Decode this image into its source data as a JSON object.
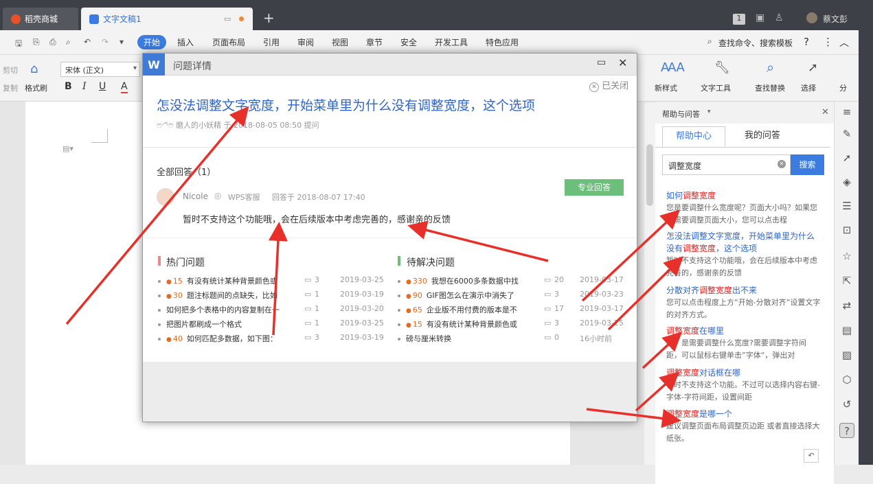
{
  "tabs": [
    {
      "label": "稻壳商城"
    },
    {
      "label": "文字文稿1"
    }
  ],
  "titlebar": {
    "user": "蔡文彭",
    "badge": "1"
  },
  "ribbon": {
    "tabs": [
      "开始",
      "插入",
      "页面布局",
      "引用",
      "审阅",
      "视图",
      "章节",
      "安全",
      "开发工具",
      "特色应用"
    ],
    "search_label": "查找命令、搜索模板"
  },
  "toolbar": {
    "cut": "剪切",
    "copy": "复制",
    "format_painter": "格式刷",
    "font": "宋体 (正文)",
    "bold": "B",
    "italic": "I",
    "underline": "U",
    "color": "A",
    "styles": "新样式",
    "text_tools": "文字工具",
    "find_replace": "查找替换",
    "select": "选择",
    "more": "分"
  },
  "dialog": {
    "title": "问题详情",
    "status": "已关闭",
    "question": "怎没法调整文字宽度，开始菜单里为什么没有调整宽度，这个选项",
    "asker_line": "磨人的小妖精 于 2018-08-05 08:50 提问",
    "asker_emoticon": "ෆ◠̈ෆ",
    "answers_header": "全部回答（1）",
    "answer": {
      "user": "Nicole",
      "role": "WPS客服",
      "time": "回答于 2018-08-07 17:40",
      "badge": "专业回答",
      "text": "暂时不支持这个功能哦，会在后续版本中考虑完善的，感谢亲的反馈"
    },
    "hot_title": "热门问题",
    "pending_title": "待解决问题",
    "hot": [
      {
        "coins": "15",
        "text": "有没有统计某种背景颜色或",
        "count": "3",
        "date": "2019-03-25"
      },
      {
        "coins": "30",
        "text": "题注标题间的点缺失，比如",
        "count": "1",
        "date": "2019-03-19"
      },
      {
        "coins": "",
        "text": "如何把多个表格中的内容复制在一",
        "count": "1",
        "date": "2019-03-20"
      },
      {
        "coins": "",
        "text": "把图片都刷成一个格式",
        "count": "1",
        "date": "2019-03-25"
      },
      {
        "coins": "40",
        "text": "如何匹配多数据，如下图：",
        "count": "3",
        "date": "2019-03-19"
      }
    ],
    "pending": [
      {
        "coins": "330",
        "text": "我想在6000多条数据中找",
        "count": "20",
        "date": "2019-03-17"
      },
      {
        "coins": "90",
        "text": "GIF图怎么在演示中消失了",
        "count": "3",
        "date": "2019-03-23"
      },
      {
        "coins": "65",
        "text": "企业版不用付费的版本是不",
        "count": "17",
        "date": "2019-03-17"
      },
      {
        "coins": "15",
        "text": "有没有统计某种背景颜色或",
        "count": "3",
        "date": "2019-03-25"
      },
      {
        "coins": "",
        "text": "磅与厘米转换",
        "count": "0",
        "date": "16小时前"
      }
    ]
  },
  "help": {
    "header": "帮助与问答",
    "tab_center": "帮助中心",
    "tab_mine": "我的问答",
    "search_value": "调整宽度",
    "search_button": "搜索",
    "results": [
      {
        "pre": "如何",
        "hl": "调整宽度",
        "post": "",
        "desc": "您是要调整什么宽度呢？页面大小吗？如果您是需要调整页面大小，您可以点击程"
      },
      {
        "pre": "怎没法调整文字宽度，开始菜单里为什么没有",
        "hl": "调整宽度",
        "post": "，这个选项",
        "desc": "暂时不支持这个功能哦，会在后续版本中考虑完善的，感谢亲的反馈"
      },
      {
        "pre": "分散对齐",
        "hl": "调整宽度",
        "post": "出不来",
        "desc": "您可以点击程度上方“开始-分散对齐”设置文字的对齐方式。"
      },
      {
        "pre": "",
        "hl": "调整宽度",
        "post": "在哪里",
        "desc": "亲，是需要调整什么宽度?需要调整字符间距，可以鼠标右键单击”字体“，弹出对"
      },
      {
        "pre": "",
        "hl": "调整宽度",
        "post": "对话框在哪",
        "desc": "暂时不支持这个功能。不过可以选择内容右键-字体-字符间距，设置间距"
      },
      {
        "pre": "",
        "hl": "调整宽度",
        "post": "是哪一个",
        "desc": "建议调整页面布局调整页边距 或者直接选择大纸张。"
      }
    ]
  },
  "colors": {
    "accent": "#3c7be0",
    "arrow": "#e8302a",
    "green": "#6cbf7b",
    "red_mark": "#e58b8b"
  }
}
